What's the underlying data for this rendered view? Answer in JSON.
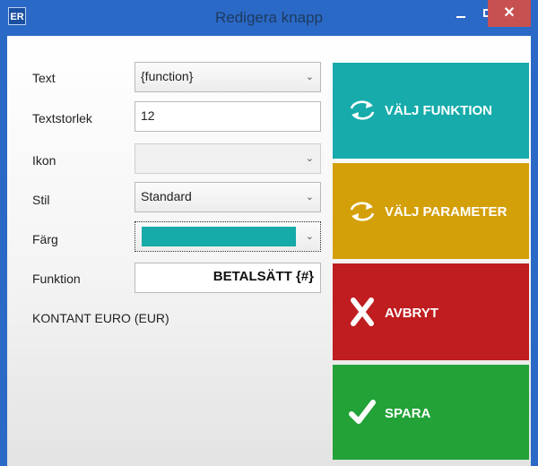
{
  "window": {
    "title": "Redigera knapp",
    "app_icon_text": "ER",
    "close_glyph": "✕"
  },
  "form": {
    "text": {
      "label": "Text",
      "value": "{function}"
    },
    "textstorlek": {
      "label": "Textstorlek",
      "value": "12"
    },
    "ikon": {
      "label": "Ikon",
      "value": ""
    },
    "stil": {
      "label": "Stil",
      "value": "Standard"
    },
    "farg": {
      "label": "Färg",
      "value": "#16aaa8"
    },
    "funktion": {
      "label": "Funktion",
      "value": "BETALSÄTT {#}"
    },
    "summary": "KONTANT EURO (EUR)",
    "dropdown_icon": "chevron-down-icon"
  },
  "buttons": {
    "valj_funktion": {
      "label": "VÄLJ FUNKTION",
      "color": "#17abab",
      "icon": "refresh-arrows-icon"
    },
    "valj_parameter": {
      "label": "VÄLJ PARAMETER",
      "color": "#d4a00a",
      "icon": "refresh-arrows-icon"
    },
    "avbryt": {
      "label": "AVBRYT",
      "color": "#bf1d1f",
      "icon": "x-icon"
    },
    "spara": {
      "label": "SPARA",
      "color": "#22a237",
      "icon": "checkmark-icon"
    }
  }
}
